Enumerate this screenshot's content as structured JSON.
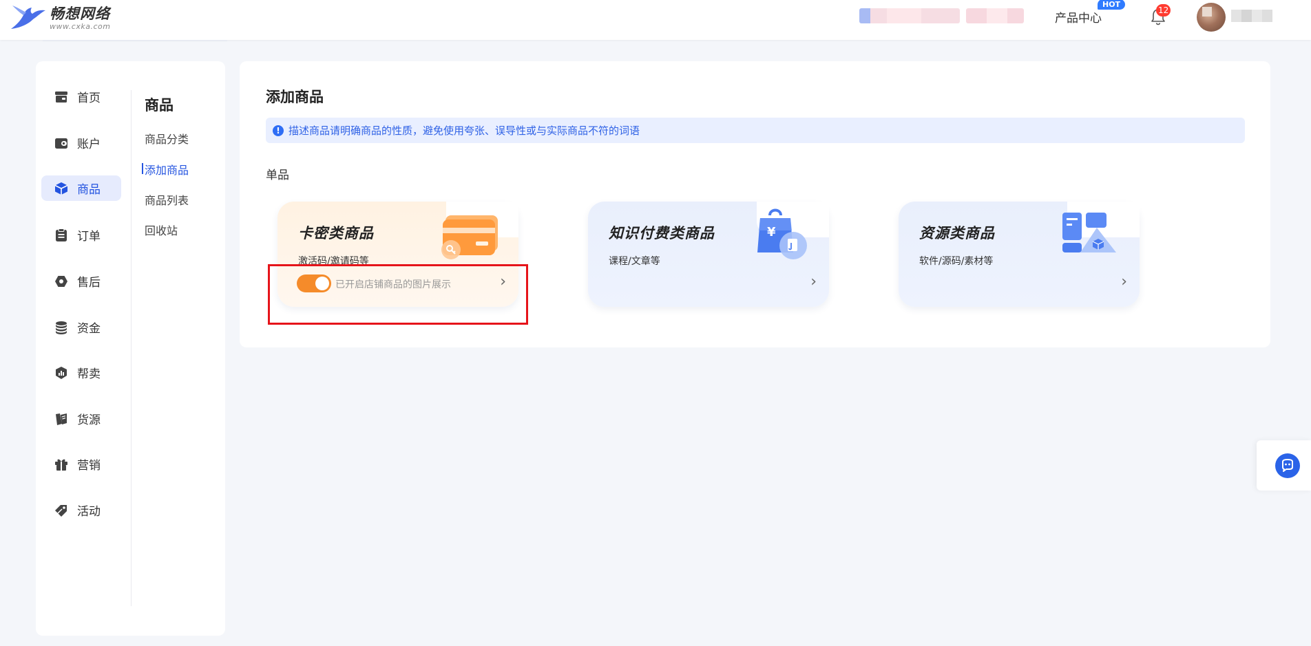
{
  "header": {
    "brand_name": "畅想网络",
    "brand_url": "www.cxka.com",
    "product_center": "产品中心",
    "hot_badge": "HOT",
    "notification_count": "12"
  },
  "sidebar": {
    "nav": [
      {
        "label": "首页",
        "icon": "store-icon"
      },
      {
        "label": "账户",
        "icon": "wallet-icon"
      },
      {
        "label": "商品",
        "icon": "cube-icon",
        "active": true
      },
      {
        "label": "订单",
        "icon": "clipboard-icon"
      },
      {
        "label": "售后",
        "icon": "hexagon-icon"
      },
      {
        "label": "资金",
        "icon": "coins-icon"
      },
      {
        "label": "帮卖",
        "icon": "chart-shield-icon"
      },
      {
        "label": "货源",
        "icon": "book-icon"
      },
      {
        "label": "营销",
        "icon": "gift-icon"
      },
      {
        "label": "活动",
        "icon": "tag-icon"
      }
    ],
    "sub_title": "商品",
    "sub_items": [
      {
        "label": "商品分类"
      },
      {
        "label": "添加商品",
        "active": true
      },
      {
        "label": "商品列表"
      },
      {
        "label": "回收站"
      }
    ]
  },
  "main": {
    "title": "添加商品",
    "notice": "描述商品请明确商品的性质，避免使用夸张、误导性或与实际商品不符的词语",
    "section_label": "单品",
    "cards": [
      {
        "title": "卡密类商品",
        "subtitle": "激活码/邀请码等",
        "toggle_label": "已开启店铺商品的图片展示",
        "toggle_on": true
      },
      {
        "title": "知识付费类商品",
        "subtitle": "课程/文章等"
      },
      {
        "title": "资源类商品",
        "subtitle": "软件/源码/素材等"
      }
    ]
  },
  "colors": {
    "accent": "#2454e0",
    "toggle": "#f58b2a",
    "highlight": "#e6141a"
  }
}
